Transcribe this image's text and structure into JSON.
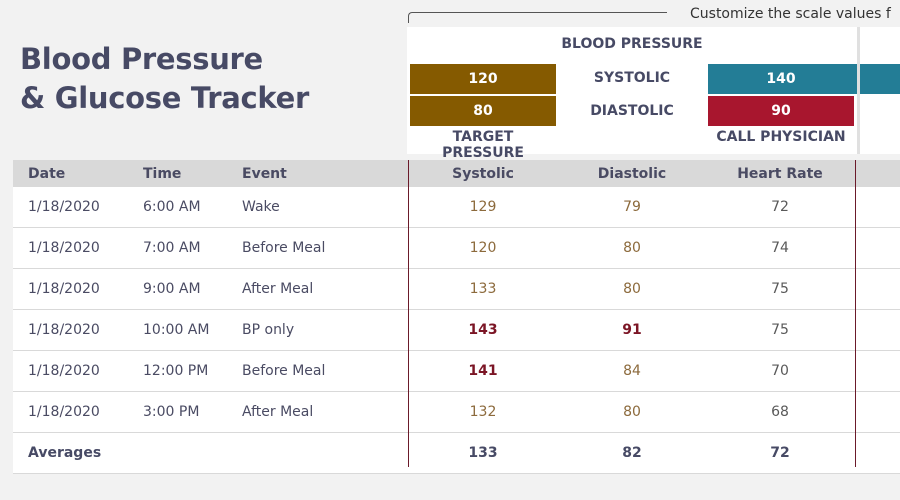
{
  "title": {
    "line1": "Blood Pressure",
    "line2": "& Glucose Tracker"
  },
  "hint": "Customize the scale values  f",
  "scale": {
    "heading": "BLOOD PRESSURE",
    "target": {
      "systolic": "120",
      "diastolic": "80",
      "label": "TARGET PRESSURE",
      "color": "#855a00"
    },
    "rows": {
      "systolic": "SYSTOLIC",
      "diastolic": "DIASTOLIC"
    },
    "physician": {
      "systolic": "140",
      "diastolic": "90",
      "label": "CALL PHYSICIAN",
      "systolic_color": "#237d96",
      "diastolic_color": "#a8162e"
    }
  },
  "table": {
    "headers": {
      "date": "Date",
      "time": "Time",
      "event": "Event",
      "systolic": "Systolic",
      "diastolic": "Diastolic",
      "heart_rate": "Heart Rate"
    },
    "rows": [
      {
        "date": "1/18/2020",
        "time": "6:00 AM",
        "event": "Wake",
        "systolic": "129",
        "diastolic": "79",
        "heart_rate": "72"
      },
      {
        "date": "1/18/2020",
        "time": "7:00 AM",
        "event": "Before Meal",
        "systolic": "120",
        "diastolic": "80",
        "heart_rate": "74"
      },
      {
        "date": "1/18/2020",
        "time": "9:00 AM",
        "event": "After Meal",
        "systolic": "133",
        "diastolic": "80",
        "heart_rate": "75"
      },
      {
        "date": "1/18/2020",
        "time": "10:00 AM",
        "event": "BP only",
        "systolic": "143",
        "diastolic": "91",
        "heart_rate": "75"
      },
      {
        "date": "1/18/2020",
        "time": "12:00 PM",
        "event": "Before Meal",
        "systolic": "141",
        "diastolic": "84",
        "heart_rate": "70"
      },
      {
        "date": "1/18/2020",
        "time": "3:00 PM",
        "event": "After Meal",
        "systolic": "132",
        "diastolic": "80",
        "heart_rate": "68"
      }
    ],
    "averages": {
      "label": "Averages",
      "systolic": "133",
      "diastolic": "82",
      "heart_rate": "72"
    }
  }
}
